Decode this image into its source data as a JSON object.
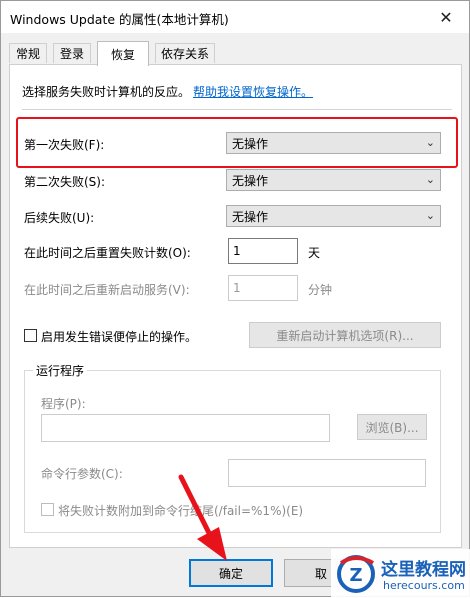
{
  "window": {
    "title": "Windows Update 的属性(本地计算机)",
    "close_glyph": "✕"
  },
  "tabs": [
    {
      "label": "常规",
      "active": false
    },
    {
      "label": "登录",
      "active": false
    },
    {
      "label": "恢复",
      "active": true
    },
    {
      "label": "依存关系",
      "active": false
    }
  ],
  "recovery": {
    "intro_text": "选择服务失败时计算机的反应。",
    "help_link": "帮助我设置恢复操作。",
    "first_failure_label": "第一次失败(F):",
    "first_failure_value": "无操作",
    "second_failure_label": "第二次失败(S):",
    "second_failure_value": "无操作",
    "subsequent_failure_label": "后续失败(U):",
    "subsequent_failure_value": "无操作",
    "reset_count_label": "在此时间之后重置失败计数(O):",
    "reset_count_value": "1",
    "reset_count_unit": "天",
    "restart_service_label": "在此时间之后重新启动服务(V):",
    "restart_service_value": "1",
    "restart_service_unit": "分钟",
    "enable_actions_label": "启用发生错误便停止的操作。",
    "restart_options_button": "重新启动计算机选项(R)..."
  },
  "run_program": {
    "group_label": "运行程序",
    "program_label": "程序(P):",
    "program_value": "",
    "browse_button": "浏览(B)...",
    "params_label": "命令行参数(C):",
    "params_value": "",
    "append_label": "将失败计数附加到命令行结尾(/fail=%1%)(E)"
  },
  "footer": {
    "ok_button": "确定",
    "cancel_button": "取"
  },
  "watermark": {
    "name": "这里教程网",
    "url": "herecours.com",
    "logo_letter": "Z"
  },
  "colors": {
    "highlight": "#e8131a",
    "link": "#0066cc"
  }
}
